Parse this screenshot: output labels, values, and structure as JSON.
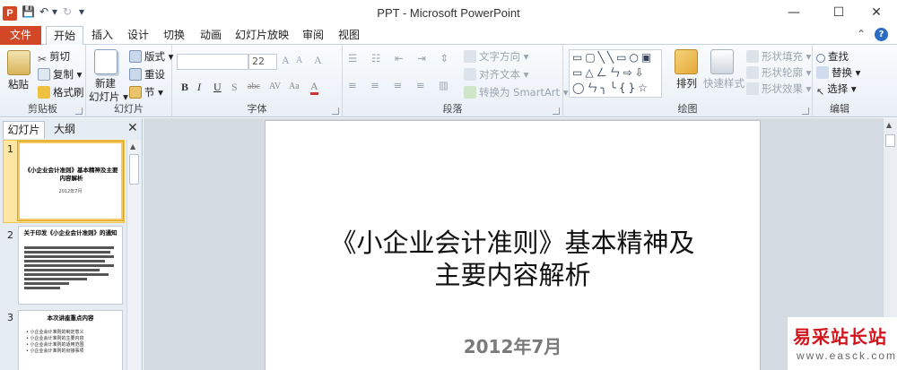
{
  "window": {
    "title": "PPT - Microsoft PowerPoint",
    "app_badge": "P",
    "controls": {
      "minimize": "—",
      "maximize": "☐",
      "close": "✕"
    }
  },
  "qat": {
    "save": "💾",
    "undo": "↶",
    "undo_drop": "▾",
    "redo": "↻",
    "customize": "▾"
  },
  "tabs": [
    {
      "label": "文件"
    },
    {
      "label": "开始"
    },
    {
      "label": "插入"
    },
    {
      "label": "设计"
    },
    {
      "label": "切换"
    },
    {
      "label": "动画"
    },
    {
      "label": "幻灯片放映"
    },
    {
      "label": "审阅"
    },
    {
      "label": "视图"
    }
  ],
  "tab_right": {
    "collapse": "⌃",
    "help": "?"
  },
  "ribbon": {
    "clipboard": {
      "label": "剪贴板",
      "paste": "粘贴",
      "cut": "剪切",
      "copy": "复制 ▾",
      "format_painter": "格式刷"
    },
    "slides": {
      "label": "幻灯片",
      "new_slide_1": "新建",
      "new_slide_2": "幻灯片 ▾",
      "layout": "版式 ▾",
      "reset": "重设",
      "section": "节 ▾"
    },
    "font": {
      "label": "字体",
      "font_name": "",
      "font_size": "22",
      "grow": "A",
      "shrink": "A",
      "clear": "A",
      "bold": "B",
      "italic": "I",
      "underline": "U",
      "shadow": "S",
      "strike": "abc",
      "spacing": "AV",
      "case": "Aa",
      "color": "A"
    },
    "paragraph": {
      "label": "段落",
      "text_direction": "文字方向 ▾",
      "align_text": "对齐文本 ▾",
      "smartart": "转换为 SmartArt ▾"
    },
    "drawing": {
      "label": "绘图",
      "shapes_row1": "▭▢╲╲▭○▣",
      "shapes_row2": "▭△ㄥㄣ⇨⇩",
      "shapes_row3": "◯ㄣ╮╰{}☆",
      "arrange": "排列",
      "quick_styles": "快速样式",
      "shape_fill": "形状填充 ▾",
      "shape_outline": "形状轮廓 ▾",
      "shape_effects": "形状效果 ▾"
    },
    "editing": {
      "label": "编辑",
      "find": "查找",
      "replace": "替换 ▾",
      "select": "选择 ▾"
    }
  },
  "panel": {
    "tab_slides": "幻灯片",
    "tab_outline": "大纲",
    "close": "✕",
    "thumbs": [
      {
        "num": "1",
        "title": "《小企业会计准则》基本精神及主要内容解析",
        "sub": "2012年7月"
      },
      {
        "num": "2",
        "title": "关于印发《小企业会计准则》的通知"
      },
      {
        "num": "3",
        "title": "本次讲座重点内容",
        "bullets": [
          "• 小企业会计准则的制定意义",
          "• 小企业会计准则的主要内容",
          "• 小企业会计准则的适用范围",
          "• 小企业会计准则的衔接事项"
        ]
      }
    ]
  },
  "slide": {
    "title_line1": "《小企业会计准则》基本精神及",
    "title_line2": "主要内容解析",
    "subtitle": "2012年7月"
  },
  "watermark": {
    "title": "易采站长站",
    "url": "www.easck.com"
  },
  "colors": {
    "file_tab": "#d24726",
    "selection": "#f5c860",
    "canvas_bg": "#d5dbe2"
  }
}
